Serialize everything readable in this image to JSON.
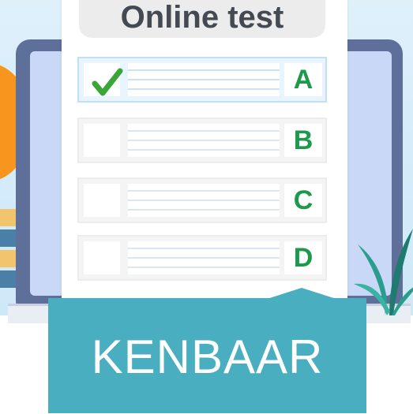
{
  "test": {
    "title": "Online test",
    "answers": [
      {
        "letter": "A",
        "checked": true
      },
      {
        "letter": "B",
        "checked": false
      },
      {
        "letter": "C",
        "checked": false
      },
      {
        "letter": "D",
        "checked": false
      }
    ]
  },
  "caption": {
    "text": "KENBAAR"
  },
  "colors": {
    "letter_green": "#1b9a4b",
    "check_green": "#3aa63a",
    "callout_teal": "#49aebf",
    "laptop_frame": "#5e6f99",
    "screen": "#c9d8f6",
    "orange_accent": "#f7961f"
  }
}
